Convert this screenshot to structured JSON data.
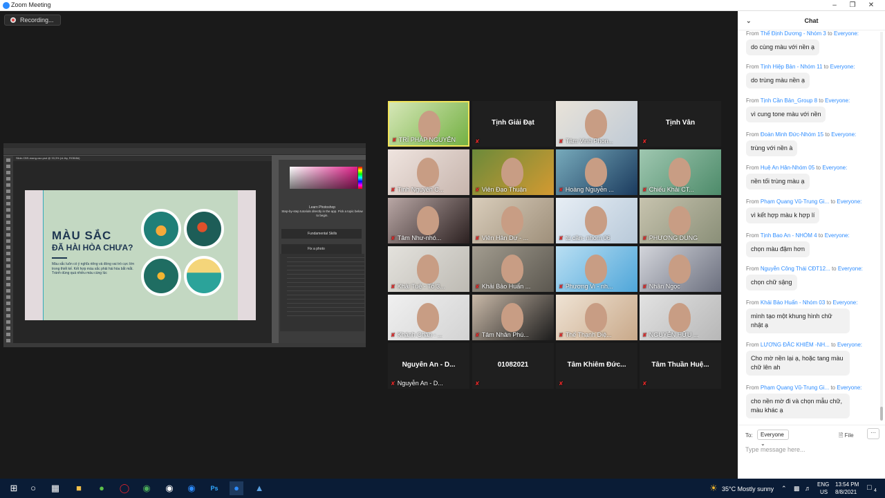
{
  "window": {
    "title": "Zoom Meeting"
  },
  "recording": {
    "label": "Recording..."
  },
  "shared_screen": {
    "app_menu": [
      "File",
      "Edit",
      "Image",
      "Layer",
      "Type",
      "Select",
      "Filter",
      "3D",
      "View",
      "Window",
      "Help"
    ],
    "doc_tab": "Slide-CBS-mang-xao.psd @ 33,3% (nl-thy, RGB/8#)",
    "slide_title1": "MÀU SẮC",
    "slide_title2": "ĐÃ HÀI HÒA CHƯA?",
    "slide_body": "Màu sắc luôn có ý nghĩa riêng và đóng vai trò cực lớn trong thiết kế. Kết hợp màu sắc phải hài hòa bắt mắt. Tránh dùng quá nhiều màu cùng lúc",
    "learn_title": "Learn Photoshop",
    "learn_text": "Step-by-step tutorials directly in the app. Pick a topic below to begin.",
    "learn_item1": "Fundamental Skills",
    "learn_item2": "Fix a photo"
  },
  "participants": [
    {
      "name": "TRÍ PHÁP NGUYỄN",
      "video": true,
      "active": true
    },
    {
      "name": "Tịnh Giải Đạt",
      "video": false
    },
    {
      "name": "Tâm Vinh Phon...",
      "video": true
    },
    {
      "name": "Tịnh Vân",
      "video": false
    },
    {
      "name": "Tịnh Nguyên C...",
      "video": true
    },
    {
      "name": "Viên Đạo Thuận",
      "video": true
    },
    {
      "name": "Hoàng Nguyễn ...",
      "video": true
    },
    {
      "name": "Chiếu Khải CT...",
      "video": true
    },
    {
      "name": "Tâm Như-nhó...",
      "video": true
    },
    {
      "name": "Viên Hân Dự - ...",
      "video": true
    },
    {
      "name": "tú cần- nhóm 06",
      "video": true
    },
    {
      "name": "PHƯƠNG DUNG",
      "video": true
    },
    {
      "name": "Khải Tuệ - Tổ 3...",
      "video": true
    },
    {
      "name": "Khải Bảo Huấn ...",
      "video": true
    },
    {
      "name": "Phương Vi - nh...",
      "video": true
    },
    {
      "name": "Nhân Ngọc",
      "video": true
    },
    {
      "name": "Khánh Chân - ...",
      "video": true
    },
    {
      "name": "Tâm Nhân Phú...",
      "video": true
    },
    {
      "name": "Thể Thạnh Diệ...",
      "video": true
    },
    {
      "name": "NGUYỄN HỮU ...",
      "video": true
    },
    {
      "name": "Nguyễn An - D...",
      "video": false,
      "center": ""
    },
    {
      "name": "",
      "video": false,
      "center": "01082021"
    },
    {
      "name": "",
      "video": false,
      "center": "Tâm Khiêm Đức..."
    },
    {
      "name": "",
      "video": false,
      "center": "Tâm Thuần Huệ..."
    }
  ],
  "chat": {
    "title": "Chat",
    "messages": [
      {
        "from": "Thể Định Dương - Nhóm 3",
        "to": "Everyone:",
        "text": "do cùng màu với nền ạ"
      },
      {
        "from": "Tịnh Hiệp Bản - Nhóm 11",
        "to": "Everyone:",
        "text": "do trùng màu nền ạ"
      },
      {
        "from": "Tịnh Cần Bản_Group 8",
        "to": "Everyone:",
        "text": "vì cung tone màu với nền"
      },
      {
        "from": "Đoàn Minh Đức-Nhóm 15",
        "to": "Everyone:",
        "text": "trùng với nền à"
      },
      {
        "from": "Huệ An Hân-Nhóm 05",
        "to": "Everyone:",
        "text": "nền tối trùng màu ạ"
      },
      {
        "from": "Phạm Quang Vũ-Trung Gi...",
        "to": "Everyone:",
        "text": "vì kết hợp màu k hợp lí"
      },
      {
        "from": "Tịnh Bao An - NHÓM 4",
        "to": "Everyone:",
        "text": "chọn màu đậm hơn"
      },
      {
        "from": "Nguyễn Công Thái CĐT12...",
        "to": "Everyone:",
        "text": "chọn chữ sậng"
      },
      {
        "from": "Khải Bảo Huấn - Nhóm 03",
        "to": "Everyone:",
        "text": "mình tạo một khung hình chữ nhật ạ"
      },
      {
        "from": "LƯƠNG ĐẮC KHIÊM -NH...",
        "to": "Everyone:",
        "text": "Cho mờ nền lại ạ, hoặc tang màu chữ lên ah"
      },
      {
        "from": "Phạm Quang Vũ-Trung Gi...",
        "to": "Everyone:",
        "text": "cho nền mờ đi và chọn mẫu chữ, màu khác ạ"
      }
    ],
    "from_label": "From",
    "to_label": "to",
    "to_prefix": "To:",
    "to_value": "Everyone",
    "file_label": "File",
    "placeholder": "Type message here..."
  },
  "taskbar": {
    "weather": "35°C  Mostly sunny",
    "lang1": "ENG",
    "lang2": "US",
    "time": "13:54 PM",
    "date": "8/8/2021",
    "notif": "4"
  }
}
